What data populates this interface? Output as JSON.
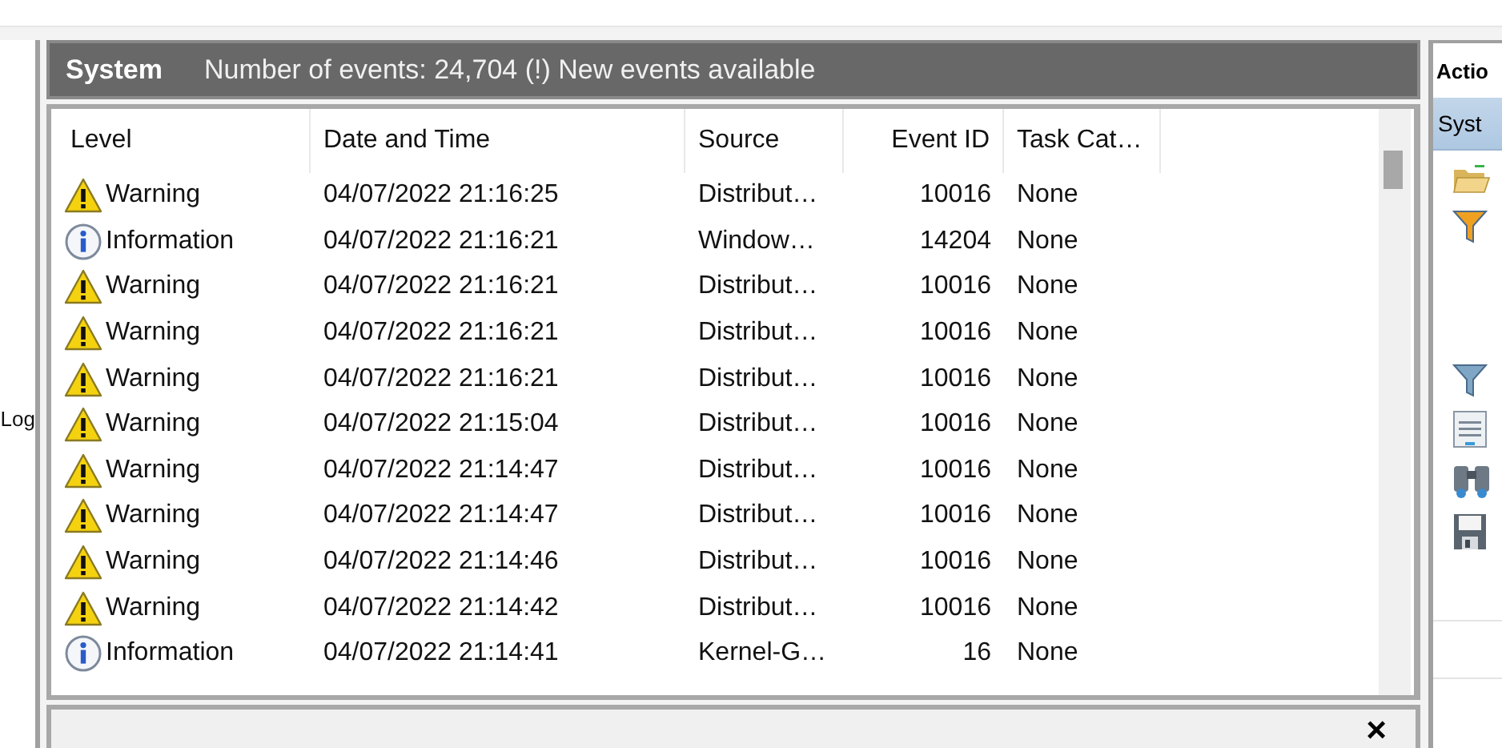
{
  "left_pane": {
    "label": "Log"
  },
  "log_header": {
    "title": "System",
    "summary": "Number of events: 24,704 (!) New events available"
  },
  "table": {
    "columns": [
      "Level",
      "Date and Time",
      "Source",
      "Event ID",
      "Task Cat…"
    ],
    "rows": [
      {
        "kind": "warning",
        "level": "Warning",
        "date_time": "04/07/2022 21:16:25",
        "source": "Distribut…",
        "event_id": "10016",
        "task_category": "None"
      },
      {
        "kind": "information",
        "level": "Information",
        "date_time": "04/07/2022 21:16:21",
        "source": "Window…",
        "event_id": "14204",
        "task_category": "None"
      },
      {
        "kind": "warning",
        "level": "Warning",
        "date_time": "04/07/2022 21:16:21",
        "source": "Distribut…",
        "event_id": "10016",
        "task_category": "None"
      },
      {
        "kind": "warning",
        "level": "Warning",
        "date_time": "04/07/2022 21:16:21",
        "source": "Distribut…",
        "event_id": "10016",
        "task_category": "None"
      },
      {
        "kind": "warning",
        "level": "Warning",
        "date_time": "04/07/2022 21:16:21",
        "source": "Distribut…",
        "event_id": "10016",
        "task_category": "None"
      },
      {
        "kind": "warning",
        "level": "Warning",
        "date_time": "04/07/2022 21:15:04",
        "source": "Distribut…",
        "event_id": "10016",
        "task_category": "None"
      },
      {
        "kind": "warning",
        "level": "Warning",
        "date_time": "04/07/2022 21:14:47",
        "source": "Distribut…",
        "event_id": "10016",
        "task_category": "None"
      },
      {
        "kind": "warning",
        "level": "Warning",
        "date_time": "04/07/2022 21:14:47",
        "source": "Distribut…",
        "event_id": "10016",
        "task_category": "None"
      },
      {
        "kind": "warning",
        "level": "Warning",
        "date_time": "04/07/2022 21:14:46",
        "source": "Distribut…",
        "event_id": "10016",
        "task_category": "None"
      },
      {
        "kind": "warning",
        "level": "Warning",
        "date_time": "04/07/2022 21:14:42",
        "source": "Distribut…",
        "event_id": "10016",
        "task_category": "None"
      },
      {
        "kind": "information",
        "level": "Information",
        "date_time": "04/07/2022 21:14:41",
        "source": "Kernel-G…",
        "event_id": "16",
        "task_category": "None"
      }
    ]
  },
  "details_pane": {
    "close": "×"
  },
  "actions_pane": {
    "title": "Actio",
    "section": "Syst"
  }
}
